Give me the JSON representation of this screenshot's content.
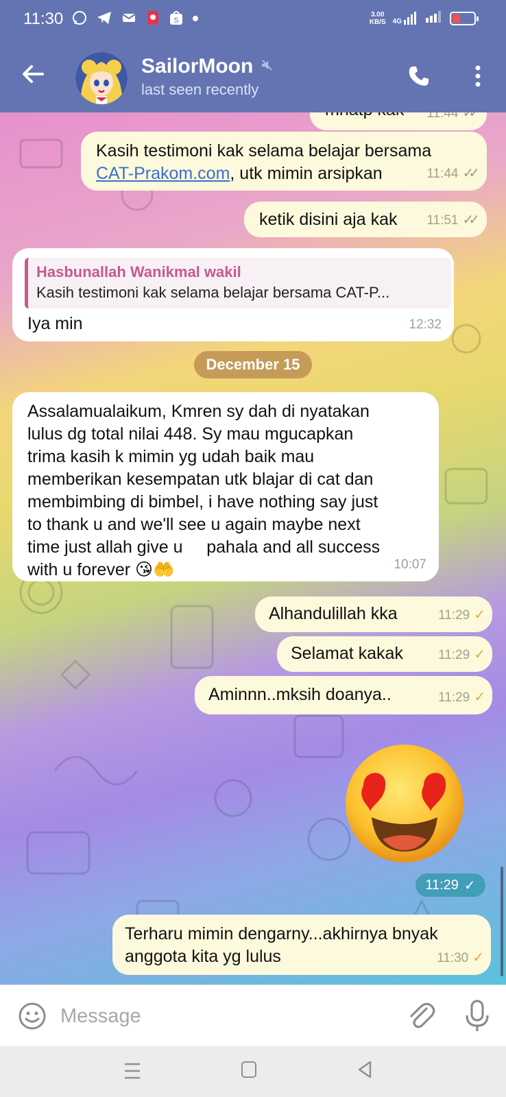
{
  "status_bar": {
    "time": "11:30",
    "app_icons": [
      "whatsapp-icon",
      "telegram-icon",
      "mail-icon",
      "app-icon",
      "shopee-icon",
      "dot-icon"
    ],
    "network_speed_value": "3.00",
    "network_speed_unit": "KB/S",
    "network_type": "4G",
    "battery_color": "#ff4d4d",
    "battery_level_fraction": 0.35
  },
  "header": {
    "contact_name": "SailorMoon",
    "status": "last seen recently",
    "muted": true,
    "background_color": "#6474b2"
  },
  "messages": [
    {
      "dir": "out",
      "text": "mnatp kak",
      "time": "11:44",
      "status": "read"
    },
    {
      "dir": "out",
      "text_before_link": "Kasih testimoni kak selama belajar bersama",
      "link": "CAT-Prakom.com",
      "text_after_link": ", utk mimin arsipkan",
      "time": "11:44",
      "status": "read"
    },
    {
      "dir": "out",
      "text": "ketik disini aja kak",
      "time": "11:51",
      "status": "read"
    },
    {
      "dir": "in",
      "reply_name": "Hasbunallah Wanikmal wakil",
      "reply_text": "Kasih testimoni kak selama belajar bersama CAT-P...",
      "text": "Iya min",
      "time": "12:32"
    },
    {
      "dir": "in",
      "lines": [
        "Assalamualaikum, Kmren sy dah di nyatakan",
        "lulus dg total nilai 448. Sy mau mgucapkan",
        "trima kasih k mimin yg udah baik mau",
        "memberikan kesempatan utk blajar di cat dan",
        "membimbing di bimbel, i have nothing say just",
        "to thank u and we'll see u again maybe next",
        "time just allah give u     pahala and all success",
        "with u forever 😘🤲"
      ],
      "time": "10:07"
    },
    {
      "dir": "out",
      "text": "Alhandulillah kka",
      "time": "11:29",
      "status": "sent"
    },
    {
      "dir": "out",
      "text": "Selamat kakak",
      "time": "11:29",
      "status": "sent"
    },
    {
      "dir": "out",
      "text": "Aminnn..mksih doanya..",
      "time": "11:29",
      "status": "sent"
    },
    {
      "dir": "out",
      "sticker": "heart-eyes-emoji",
      "time": "11:29",
      "status": "sent"
    },
    {
      "dir": "out",
      "lines": [
        "Terharu mimin dengarny...akhirnya bnyak",
        "anggota kita yg lulus"
      ],
      "time": "11:30",
      "status": "sent"
    }
  ],
  "date_separator": "December 15",
  "input": {
    "placeholder": "Message"
  },
  "colors": {
    "outgoing_bubble": "#fdf9dc",
    "incoming_bubble": "#ffffff",
    "check_color": "#e0a93b",
    "reply_accent": "#c7598d",
    "link_color": "#3a6fd0"
  }
}
